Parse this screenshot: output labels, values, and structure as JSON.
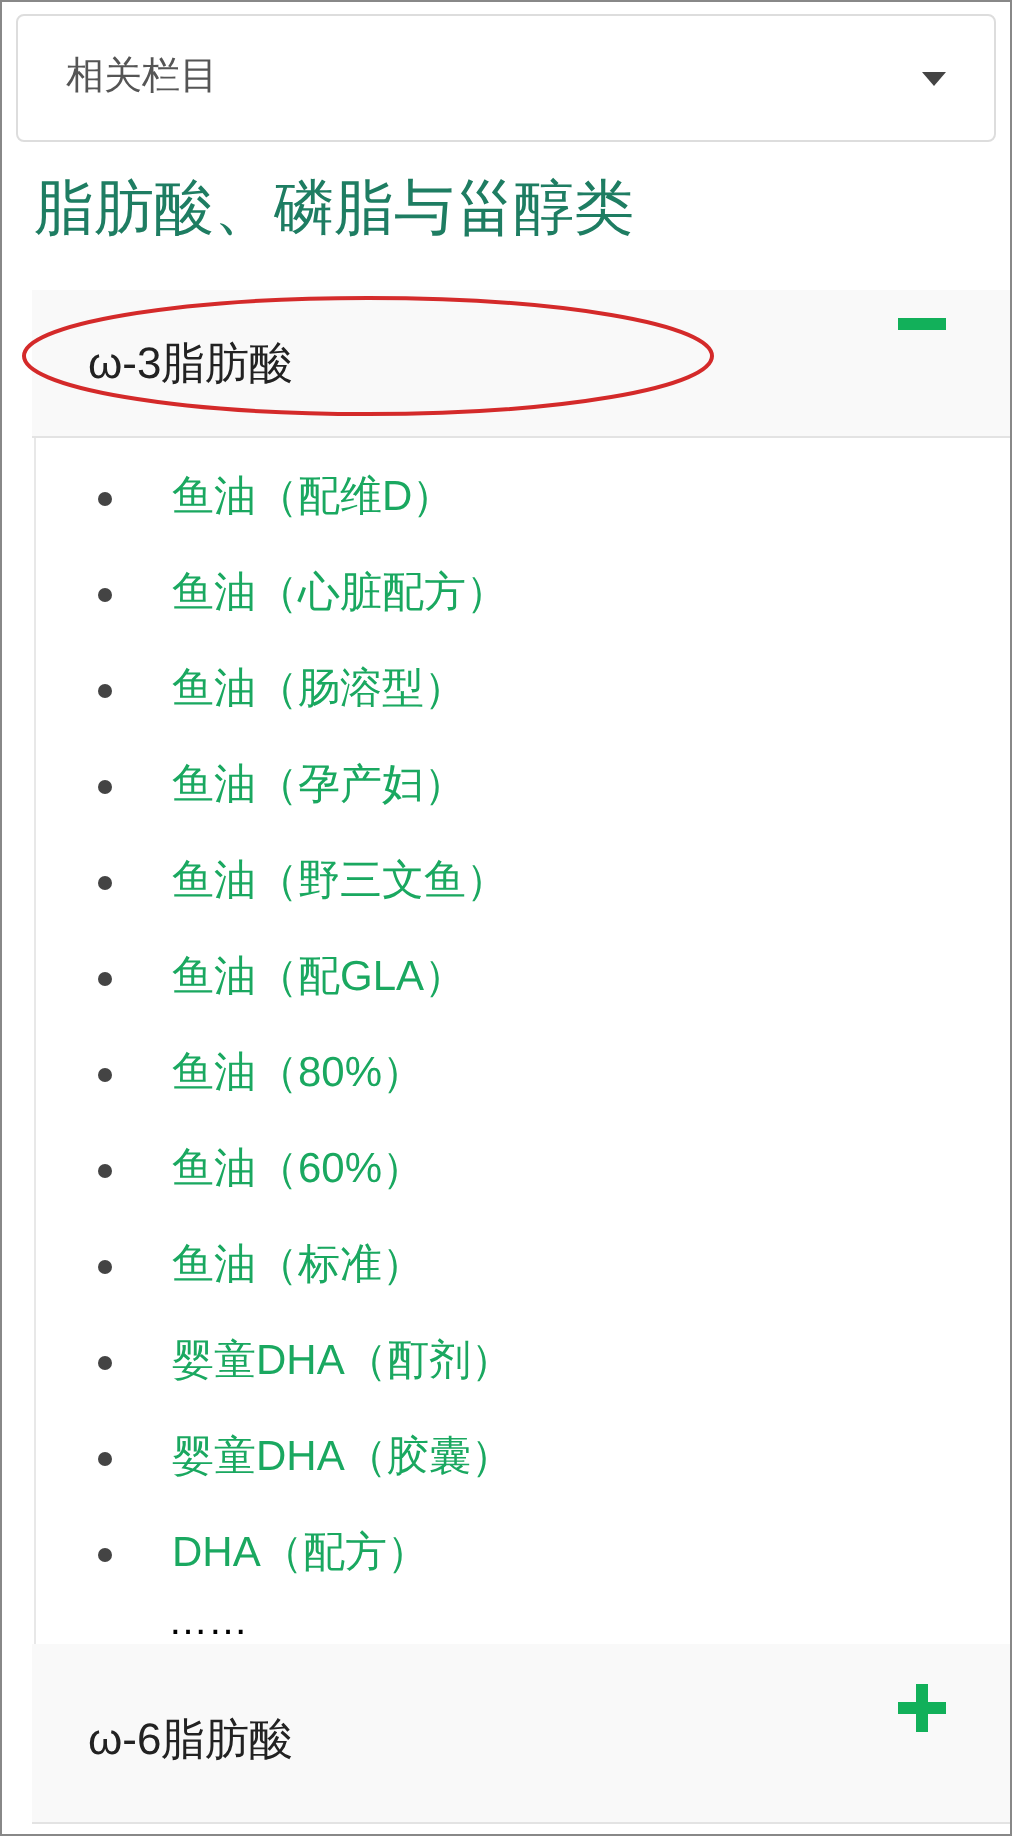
{
  "dropdown": {
    "label": "相关栏目"
  },
  "heading": "脂肪酸、磷脂与甾醇类",
  "sections": [
    {
      "title": "ω-3脂肪酸",
      "expanded": true,
      "circled": true,
      "items": [
        "鱼油（配维D）",
        "鱼油（心脏配方）",
        "鱼油（肠溶型）",
        "鱼油（孕产妇）",
        "鱼油（野三文鱼）",
        "鱼油（配GLA）",
        "鱼油（80%）",
        "鱼油（60%）",
        "鱼油（标准）",
        "婴童DHA（酊剂）",
        "婴童DHA（胶囊）",
        "DHA（配方）"
      ],
      "more": "……"
    },
    {
      "title": "ω-6脂肪酸",
      "expanded": false,
      "circled": false
    }
  ]
}
